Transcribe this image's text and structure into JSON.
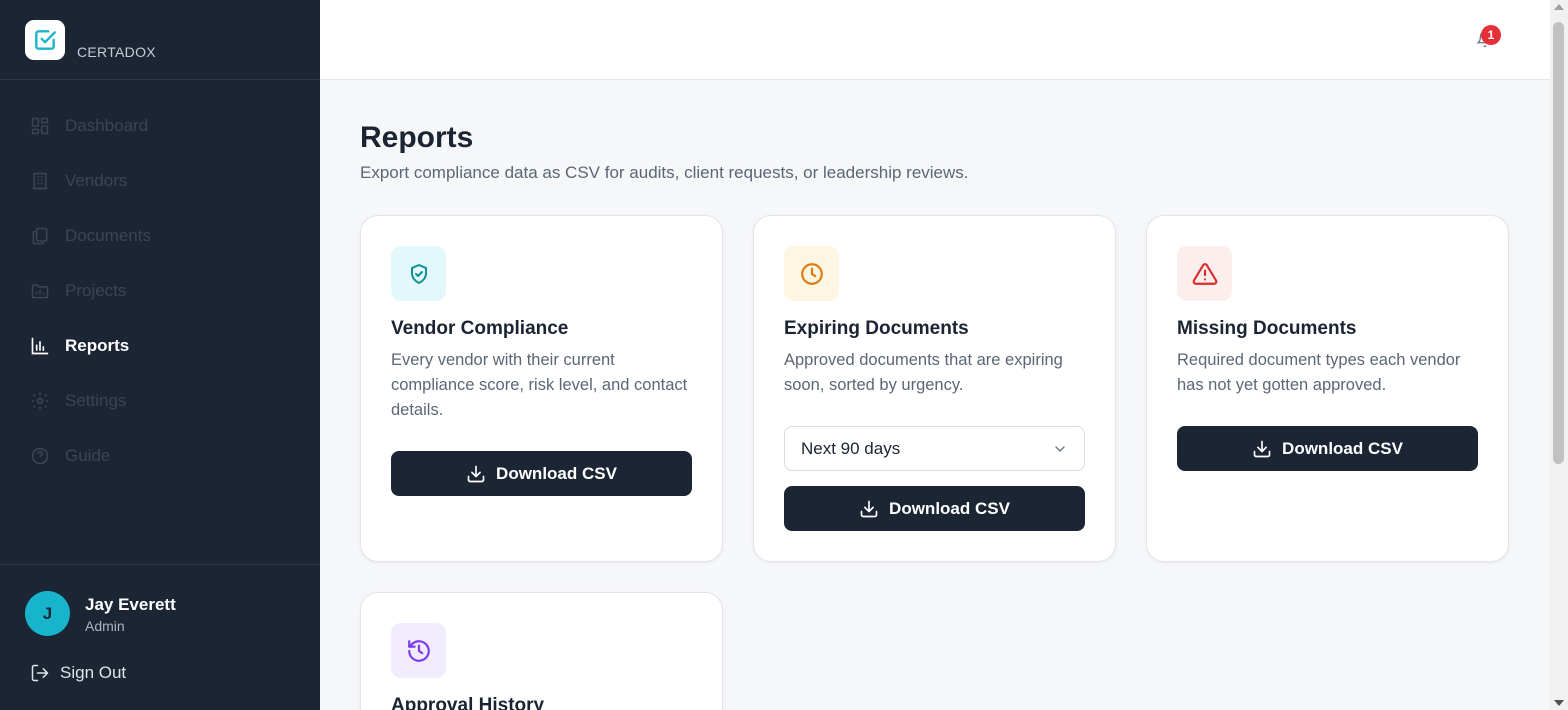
{
  "brand": {
    "name": "CERTADOX",
    "accent": "#18b4cc"
  },
  "nav": {
    "items": [
      {
        "label": "Dashboard",
        "icon": "grid-icon",
        "active": false
      },
      {
        "label": "Vendors",
        "icon": "building-icon",
        "active": false
      },
      {
        "label": "Documents",
        "icon": "documents-icon",
        "active": false
      },
      {
        "label": "Projects",
        "icon": "folder-chart-icon",
        "active": false
      },
      {
        "label": "Reports",
        "icon": "bar-chart-icon",
        "active": true
      },
      {
        "label": "Settings",
        "icon": "gear-icon",
        "active": false
      },
      {
        "label": "Guide",
        "icon": "help-circle-icon",
        "active": false
      }
    ]
  },
  "user": {
    "initial": "J",
    "name": "Jay Everett",
    "role": "Admin",
    "sign_out_label": "Sign Out"
  },
  "topbar": {
    "notification_count": "1"
  },
  "page": {
    "title": "Reports",
    "subtitle": "Export compliance data as CSV for audits, client requests, or leadership reviews."
  },
  "cards": [
    {
      "title": "Vendor Compliance",
      "description": "Every vendor with their current compliance score, risk level, and contact details.",
      "button_label": "Download CSV",
      "icon": "shield-check-icon",
      "icon_color": "#0e8f93",
      "icon_bg": "#e3f8fa"
    },
    {
      "title": "Expiring Documents",
      "description": "Approved documents that are expiring soon, sorted by urgency.",
      "select_value": "Next 90 days",
      "button_label": "Download CSV",
      "icon": "clock-icon",
      "icon_color": "#e07a10",
      "icon_bg": "#fdf6e3"
    },
    {
      "title": "Missing Documents",
      "description": "Required document types each vendor has not yet gotten approved.",
      "button_label": "Download CSV",
      "icon": "warning-triangle-icon",
      "icon_color": "#d92d2d",
      "icon_bg": "#fdeeee"
    },
    {
      "title": "Approval History",
      "icon": "history-icon",
      "icon_color": "#7c3aed",
      "icon_bg": "#f1ecfd"
    }
  ]
}
